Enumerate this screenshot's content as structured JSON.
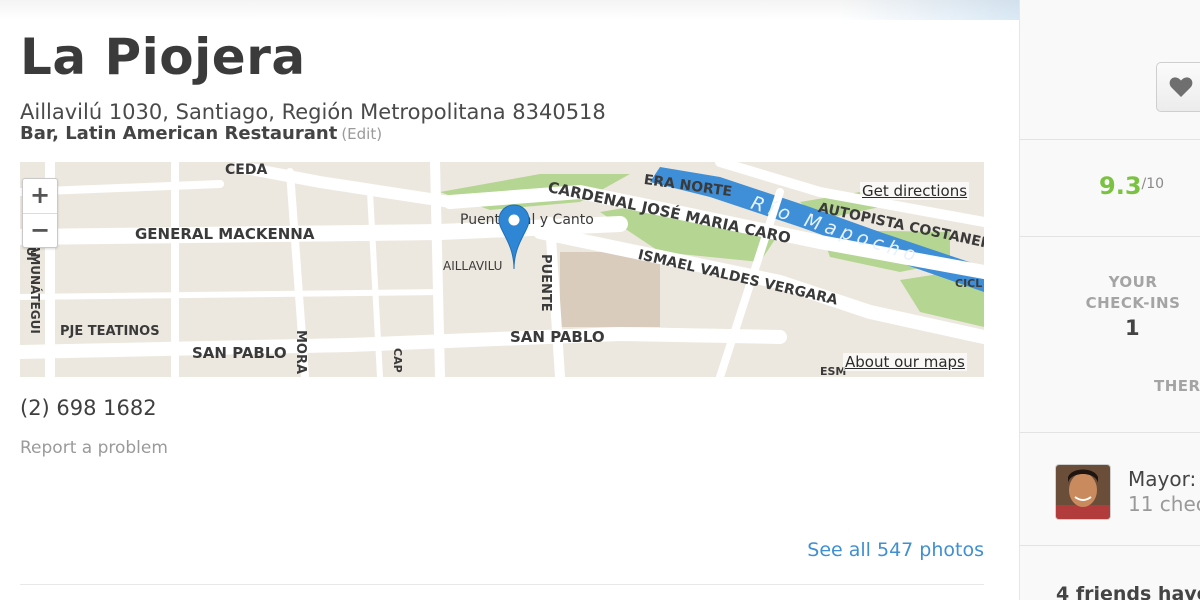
{
  "venue": {
    "name": "La Piojera",
    "address": "Aillavilú 1030, Santiago, Región Metropolitana 8340518",
    "categories": "Bar, Latin American Restaurant",
    "edit_label": "(Edit)",
    "phone": "(2) 698 1682",
    "report_label": "Report a problem",
    "photos_link": "See all 547 photos"
  },
  "map": {
    "get_directions": "Get directions",
    "about_maps": "About our maps",
    "zoom_in": "+",
    "zoom_out": "−",
    "labels": {
      "general_mackenna": "GENERAL MACKENNA",
      "cardenal": "CARDENAL JOSÉ MARIA CARO",
      "ismael": "ISMAEL VALDES VERGARA",
      "autopista": "AUTOPISTA COSTANERA",
      "rio_mapocho": "Río Mapocho",
      "era_norte": "ERA NORTE",
      "puente_canto": "Puente Cal y Canto",
      "aillavilu": "AILLAVILU",
      "puente": "PUENTE",
      "san_pablo_left": "SAN PABLO",
      "san_pablo_right": "SAN PABLO",
      "pje_teatinos": "PJE TEATINOS",
      "amunategui_1": "AMUNÁTEGUI",
      "amunategui_2": "NÁTEGUI",
      "mora": "MORA",
      "ceda": "CEDA",
      "cicl": "CICL",
      "cap": "CAP",
      "esm": "ESM"
    },
    "colors": {
      "land": "#ede8df",
      "road": "#ffffff",
      "park": "#b5d692",
      "water": "#3e8fd8",
      "pin": "#2f86d4"
    }
  },
  "sidebar": {
    "like_icon": "heart-icon",
    "rating_score": "9.3",
    "rating_outof": "/10",
    "checkins_label_line1": "YOUR",
    "checkins_label_line2": "CHECK-INS",
    "checkins_value": "1",
    "there_label": "THER",
    "mayor_label": "Mayor:",
    "mayor_sub": "11 chec",
    "friends_text": "4 friends have"
  },
  "colors": {
    "accent": "#3f8fd2",
    "rating": "#7cc242"
  }
}
